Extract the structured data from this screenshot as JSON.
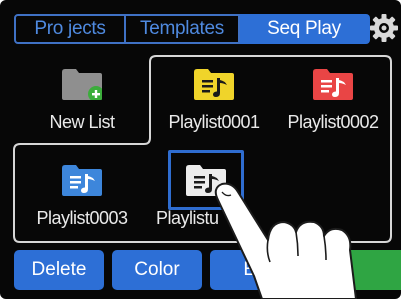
{
  "tabs": [
    {
      "label": "Pro jects",
      "active": false
    },
    {
      "label": "Templates",
      "active": false
    },
    {
      "label": "Seq Play",
      "active": true
    }
  ],
  "items": [
    {
      "label": "New List",
      "icon": "new-list-folder-icon",
      "color": "#8f8f8f"
    },
    {
      "label": "Playlist0001",
      "icon": "playlist-icon",
      "color": "#f0d42a"
    },
    {
      "label": "Playlist0002",
      "icon": "playlist-icon",
      "color": "#e94545"
    },
    {
      "label": "Playlist0003",
      "icon": "playlist-icon",
      "color": "#3d86db"
    },
    {
      "label": "Playlistu",
      "icon": "playlist-icon",
      "color": "#ececec"
    }
  ],
  "buttons": {
    "delete": "Delete",
    "color": "Color",
    "edit": "Ed"
  },
  "colors": {
    "accent": "#2d6fd6",
    "green": "#2fa543",
    "background": "#070707"
  }
}
